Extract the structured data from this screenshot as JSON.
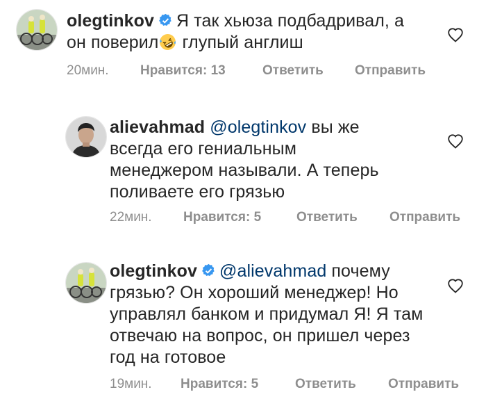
{
  "comments": [
    {
      "username": "olegtinkov",
      "verified": true,
      "text_before": "Я так хьюза подбадривал, а",
      "text_line2_before": "он поверил",
      "emoji": "rolling-on-floor-laughing-emoji",
      "text_after": " глупый англиш",
      "time": "20мин.",
      "likes": "Нравится: 13",
      "reply": "Ответить",
      "send": "Отправить"
    },
    {
      "username": "alievahmad",
      "verified": false,
      "mention": "@olegtinkov",
      "text": " вы же всегда его гениальным менеджером называли. А теперь поливаете его грязью",
      "time": "22мин.",
      "likes": "Нравится: 5",
      "reply": "Ответить",
      "send": "Отправить"
    },
    {
      "username": "olegtinkov",
      "verified": true,
      "mention": "@alievahmad",
      "text": " почему грязью? Он хороший менеджер! Но управлял банком и придумал Я! Я там отвечаю на вопрос, он пришел через год на готовое",
      "time": "19мин.",
      "likes": "Нравится: 5",
      "reply": "Ответить",
      "send": "Отправить"
    }
  ],
  "colors": {
    "text": "#262626",
    "secondary": "#8e8e8e",
    "mention": "#00376b",
    "verified": "#3897f0"
  }
}
